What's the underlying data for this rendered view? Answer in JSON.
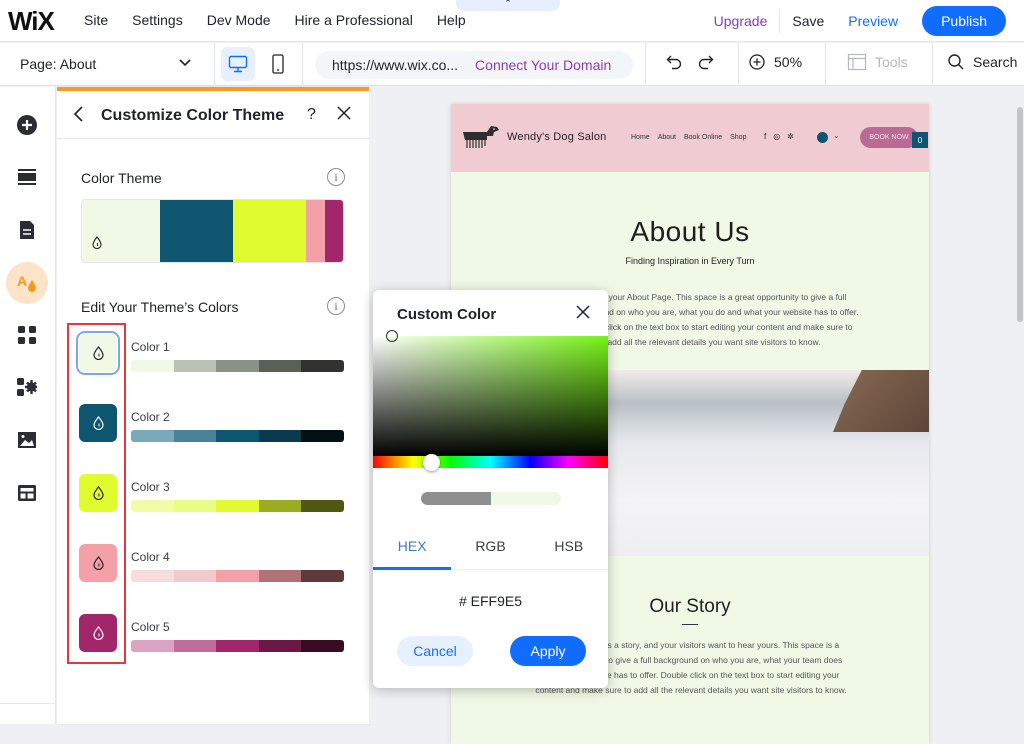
{
  "topbar": {
    "logo": "WiX",
    "menu": [
      "Site",
      "Settings",
      "Dev Mode",
      "Hire a Professional",
      "Help"
    ],
    "collapse_glyph": "⌃",
    "upgrade": "Upgrade",
    "save": "Save",
    "preview": "Preview",
    "publish": "Publish"
  },
  "secondbar": {
    "page_label": "Page: About",
    "url": "https://www.wix.co...",
    "connect_domain": "Connect Your Domain",
    "zoom_level": "50%",
    "tools": "Tools",
    "search": "Search"
  },
  "rail": {
    "items": [
      {
        "icon": "add-icon"
      },
      {
        "icon": "sections-icon"
      },
      {
        "icon": "pages-icon"
      },
      {
        "icon": "design-icon",
        "active": true
      },
      {
        "icon": "apps-icon"
      },
      {
        "icon": "business-apps-icon"
      },
      {
        "icon": "media-icon"
      },
      {
        "icon": "cms-icon"
      }
    ]
  },
  "panel": {
    "title": "Customize Color Theme",
    "help": "?",
    "theme_section": "Color Theme",
    "edit_section": "Edit Your Theme’s Colors",
    "info_glyph": "i",
    "theme_colors": [
      "#eff9e5",
      "#0e5570",
      "#e0fb2e",
      "#f3a0a8",
      "#a2266a"
    ],
    "colors": [
      {
        "label": "Color 1",
        "base": "#eff9e5",
        "shades": [
          "#eff9e5",
          "#bac2b3",
          "#8a9187",
          "#5b5f59",
          "#2f322e"
        ],
        "selected": true
      },
      {
        "label": "Color 2",
        "base": "#0e5570",
        "shades": [
          "#7aa9ba",
          "#4a8298",
          "#0e5570",
          "#093a4e",
          "#031016"
        ]
      },
      {
        "label": "Color 3",
        "base": "#e0fb2e",
        "shades": [
          "#f0fca6",
          "#e9fc84",
          "#e0fb2e",
          "#9aac1f",
          "#4f5710"
        ]
      },
      {
        "label": "Color 4",
        "base": "#f3a0a8",
        "shades": [
          "#f8dde0",
          "#f2c9cd",
          "#f3a0a8",
          "#b07177",
          "#5f3a3d"
        ]
      },
      {
        "label": "Color 5",
        "base": "#a2266a",
        "shades": [
          "#dda3c3",
          "#c16d9b",
          "#a2266a",
          "#6b1846",
          "#380b23"
        ]
      }
    ]
  },
  "site": {
    "brand": "Wendy's Dog Salon",
    "nav": [
      "Home",
      "About",
      "Book Online",
      "Shop"
    ],
    "social": [
      "f",
      "◎",
      "✲"
    ],
    "book_now": "BOOK NOW",
    "cart_count": "0",
    "about_title": "About Us",
    "about_subtitle": "Finding Inspiration in Every Turn",
    "about_body": "This is your About Page. This space is a great opportunity to give a full background on who you are, what you do and what your website has to offer. Double click on the text box to start editing your content and make sure to add all the relevant details you want site visitors to know.",
    "story_title": "Our Story",
    "story_body": "Every website has a story, and your visitors want to hear yours. This space is a great opportunity to give a full background on who you are, what your team does and what your site has to offer. Double click on the text box to start editing your content and make sure to add all the relevant details you want site visitors to know."
  },
  "picker": {
    "title": "Custom Color",
    "tabs": [
      "HEX",
      "RGB",
      "HSB"
    ],
    "active_tab": "HEX",
    "hex_value": "# EFF9E5",
    "cancel": "Cancel",
    "apply": "Apply",
    "old_color": "#8f8f8f",
    "new_color": "#eff9e5"
  }
}
